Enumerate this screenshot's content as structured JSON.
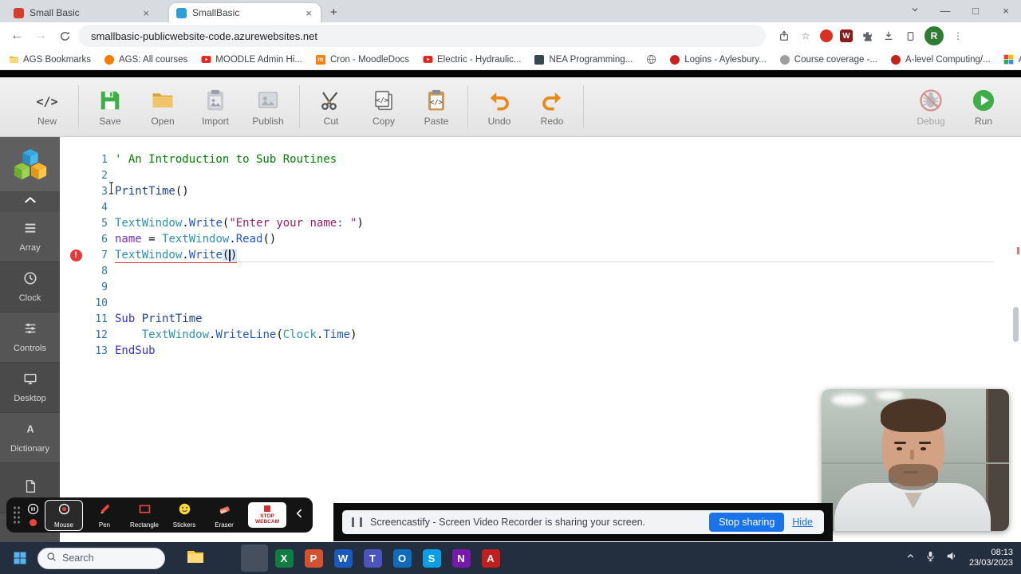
{
  "glyphs": {
    "close": "×",
    "minimize": "—",
    "maximize": "□",
    "new_tab": "+",
    "overflow": "»",
    "menu": "⋮",
    "star": "☆",
    "back": "←",
    "forward": "→",
    "error_mark": "!"
  },
  "colors": {
    "accent_blue": "#1a73e8",
    "error_red": "#e53935",
    "run_green": "#3fae49",
    "undo_orange": "#e8891c",
    "sidebar_accent": "#1b7fd4",
    "taskbar_bg": "#232e3e",
    "tokens": {
      "comment": "#008000",
      "keyword": "#3333cc",
      "class": "#2b91af",
      "method": "#2456c4",
      "variable": "#7b2fbe",
      "string": "#96216a",
      "identifier": "#1c4587",
      "plain": "#111111",
      "line_number": "#2e74b5"
    }
  },
  "browser": {
    "tabs": [
      {
        "title": "Small Basic"
      },
      {
        "title": "SmallBasic"
      }
    ],
    "url": "smallbasic-publicwebsite-code.azurewebsites.net",
    "bookmarks": [
      {
        "label": "AGS Bookmarks",
        "icon": "folder"
      },
      {
        "label": "AGS: All courses",
        "icon": "orange"
      },
      {
        "label": "MOODLE Admin Hi...",
        "icon": "youtube"
      },
      {
        "label": "Cron - MoodleDocs",
        "icon": "moodle"
      },
      {
        "label": "Electric - Hydraulic...",
        "icon": "youtube"
      },
      {
        "label": "NEA Programming...",
        "icon": "dark"
      },
      {
        "label": "",
        "icon": "globe"
      },
      {
        "label": "Logins - Aylesbury...",
        "icon": "red"
      },
      {
        "label": "Course coverage -...",
        "icon": "gray"
      },
      {
        "label": "A-level Computing/...",
        "icon": "red"
      },
      {
        "label": "Arts & Culture Expe...",
        "icon": "multi"
      }
    ]
  },
  "ide_toolbar": {
    "buttons": [
      {
        "label": "New",
        "icon": "new"
      },
      {
        "label": "Save",
        "icon": "save"
      },
      {
        "label": "Open",
        "icon": "open"
      },
      {
        "label": "Import",
        "icon": "import"
      },
      {
        "label": "Publish",
        "icon": "publish"
      },
      {
        "label": "Cut",
        "icon": "cut"
      },
      {
        "label": "Copy",
        "icon": "copy"
      },
      {
        "label": "Paste",
        "icon": "paste"
      },
      {
        "label": "Undo",
        "icon": "undo"
      },
      {
        "label": "Redo",
        "icon": "redo"
      },
      {
        "label": "Debug",
        "icon": "debug",
        "disabled": true
      },
      {
        "label": "Run",
        "icon": "run"
      }
    ]
  },
  "sidebar": {
    "items": [
      {
        "label": "Array",
        "icon": "array"
      },
      {
        "label": "Clock",
        "icon": "clock"
      },
      {
        "label": "Controls",
        "icon": "controls"
      },
      {
        "label": "Desktop",
        "icon": "desktop"
      },
      {
        "label": "Dictionary",
        "icon": "dictionary"
      },
      {
        "label": "",
        "icon": "file"
      }
    ]
  },
  "editor": {
    "lines": [
      {
        "num": 1,
        "segments": [
          {
            "t": "comment",
            "s": "' An Introduction to Sub Routines"
          }
        ]
      },
      {
        "num": 2,
        "segments": []
      },
      {
        "num": 3,
        "segments": [
          {
            "t": "identifier",
            "s": "PrintTime"
          },
          {
            "t": "plain",
            "s": "()"
          }
        ]
      },
      {
        "num": 4,
        "segments": []
      },
      {
        "num": 5,
        "segments": [
          {
            "t": "class",
            "s": "TextWindow"
          },
          {
            "t": "plain",
            "s": "."
          },
          {
            "t": "method",
            "s": "Write"
          },
          {
            "t": "plain",
            "s": "("
          },
          {
            "t": "string",
            "s": "\"Enter your name: \""
          },
          {
            "t": "plain",
            "s": ")"
          }
        ]
      },
      {
        "num": 6,
        "segments": [
          {
            "t": "variable",
            "s": "name"
          },
          {
            "t": "plain",
            "s": " = "
          },
          {
            "t": "class",
            "s": "TextWindow"
          },
          {
            "t": "plain",
            "s": "."
          },
          {
            "t": "method",
            "s": "Read"
          },
          {
            "t": "plain",
            "s": "()"
          }
        ]
      },
      {
        "num": 7,
        "error": true,
        "underline": true,
        "segments": [
          {
            "t": "class",
            "s": "TextWindow"
          },
          {
            "t": "plain",
            "s": "."
          },
          {
            "t": "method",
            "s": "Write"
          },
          {
            "t": "bracket",
            "s": "("
          },
          {
            "t": "caret",
            "s": ""
          },
          {
            "t": "bracket",
            "s": ")"
          }
        ]
      },
      {
        "num": 8,
        "segments": []
      },
      {
        "num": 9,
        "segments": []
      },
      {
        "num": 10,
        "segments": []
      },
      {
        "num": 11,
        "segments": [
          {
            "t": "keyword",
            "s": "Sub"
          },
          {
            "t": "plain",
            "s": " "
          },
          {
            "t": "identifier",
            "s": "PrintTime"
          }
        ]
      },
      {
        "num": 12,
        "segments": [
          {
            "t": "plain",
            "s": "    "
          },
          {
            "t": "class",
            "s": "TextWindow"
          },
          {
            "t": "plain",
            "s": "."
          },
          {
            "t": "method",
            "s": "WriteLine"
          },
          {
            "t": "plain",
            "s": "("
          },
          {
            "t": "class",
            "s": "Clock"
          },
          {
            "t": "plain",
            "s": "."
          },
          {
            "t": "method",
            "s": "Time"
          },
          {
            "t": "plain",
            "s": ")"
          }
        ]
      },
      {
        "num": 13,
        "segments": [
          {
            "t": "keyword",
            "s": "EndSub"
          }
        ]
      }
    ]
  },
  "screencastify": {
    "tools": [
      {
        "label": "Mouse",
        "icon": "mouse",
        "selected": true
      },
      {
        "label": "Pen",
        "icon": "pen"
      },
      {
        "label": "Rectangle",
        "icon": "rectangle"
      },
      {
        "label": "Stickers",
        "icon": "stickers"
      },
      {
        "label": "Eraser",
        "icon": "eraser"
      }
    ],
    "stop_webcam_label": "STOP WEBCAM",
    "notification": {
      "message": "Screencastify - Screen Video Recorder is sharing your screen.",
      "stop_button": "Stop sharing",
      "hide_link": "Hide"
    }
  },
  "taskbar": {
    "search_placeholder": "Search",
    "apps": [
      {
        "name": "file-explorer"
      },
      {
        "name": "edge"
      },
      {
        "name": "chrome",
        "active": true
      },
      {
        "name": "excel"
      },
      {
        "name": "powerpoint"
      },
      {
        "name": "word"
      },
      {
        "name": "teams"
      },
      {
        "name": "outlook"
      },
      {
        "name": "skype"
      },
      {
        "name": "onenote"
      },
      {
        "name": "acrobat"
      }
    ],
    "clock": {
      "time": "08:13",
      "date": "23/03/2023"
    }
  }
}
